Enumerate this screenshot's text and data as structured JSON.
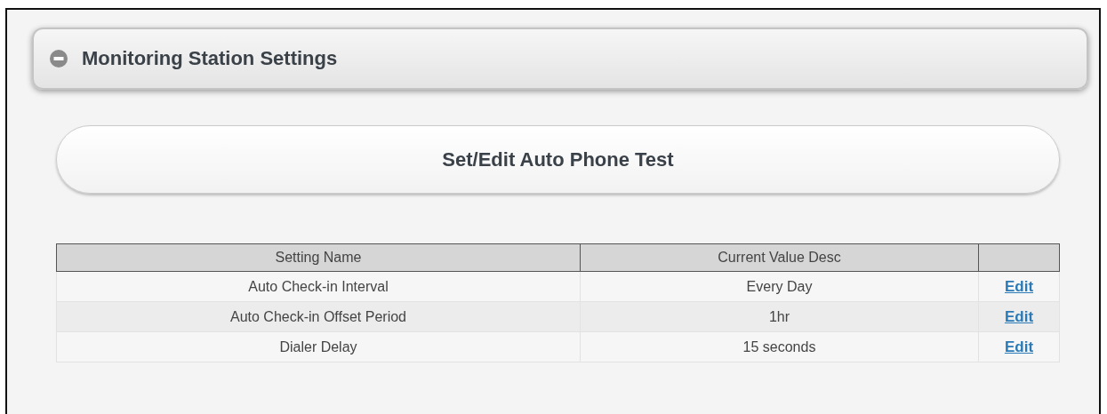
{
  "panel": {
    "title": "Monitoring Station Settings",
    "expanded": true
  },
  "action_button": "Set/Edit Auto Phone Test",
  "table": {
    "columns": [
      "Setting Name",
      "Current Value Desc"
    ],
    "rows": [
      {
        "name": "Auto Check-in Interval",
        "value": "Every Day",
        "action": "Edit"
      },
      {
        "name": "Auto Check-in Offset Period",
        "value": "1hr",
        "action": "Edit"
      },
      {
        "name": "Dialer Delay",
        "value": "15 seconds",
        "action": "Edit"
      }
    ]
  }
}
